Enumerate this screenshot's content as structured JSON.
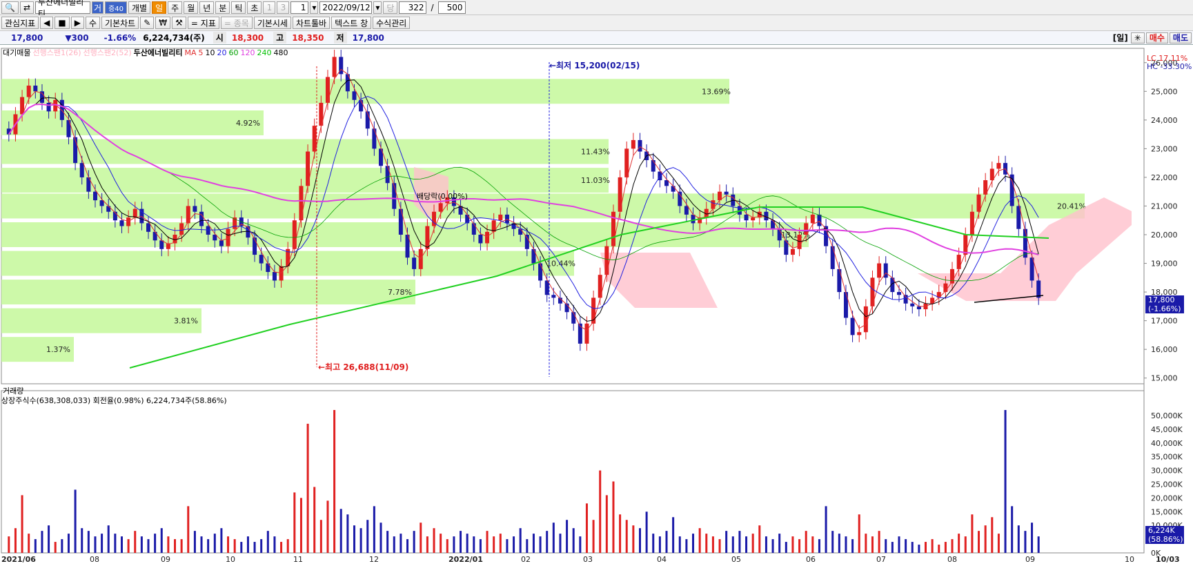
{
  "toolbar1": {
    "stock_name": "두산에너빌리티",
    "badge": "거",
    "badge2": "증40",
    "mode": "개별",
    "periods": [
      "일",
      "주",
      "월",
      "년",
      "분",
      "틱",
      "초"
    ],
    "period_nums": [
      "1",
      "3"
    ],
    "count_value": "1",
    "date_value": "2022/09/12",
    "date_prefix": "당",
    "view_count": "322",
    "slash": "/",
    "total_count": "500"
  },
  "toolbar2": {
    "indicator_label": "관심지표",
    "nav_buttons": [
      "◀",
      "■",
      "▶",
      "수"
    ],
    "basic_chart": "기본차트",
    "indicator_btn": "= 지표",
    "item_btn": "= 종목",
    "basic_quote": "기본시세",
    "chart_tools": "차트툴바",
    "text_window": "텍스트 창",
    "formula_mgmt": "수식관리"
  },
  "quote": {
    "price": "17,800",
    "change": "▼300",
    "change_pct": "-1.66%",
    "volume": "6,224,734(주)",
    "open_label": "시",
    "open": "18,300",
    "high_label": "고",
    "high": "18,350",
    "low_label": "저",
    "low": "17,800",
    "right_day": "[일]",
    "buy": "매수",
    "sell": "매도"
  },
  "legend": {
    "item1": "대기매물",
    "item2": "선행스팬1(26)",
    "item3": "선행스팬2(52)",
    "stock": "두산에너빌리티",
    "ma_label": "MA",
    "ma": [
      "5",
      "10",
      "20",
      "60",
      "120",
      "240",
      "480"
    ],
    "ma_colors": [
      "#e03030",
      "#000000",
      "#2020e0",
      "#00a000",
      "#e040e0",
      "#00c000",
      "#000000"
    ]
  },
  "right_info": {
    "lc": "LC  17.11%",
    "hc": "HC -33.30%",
    "price_tag": "17,800",
    "pct_tag": "(-1.66%)",
    "vol_tag": "6,224K",
    "vol_pct_tag": "(58.86%)"
  },
  "annotations": {
    "low": "←최저 15,200(02/15)",
    "high": "←최고 26,688(11/09)",
    "dividend": "배당락(0.00%)"
  },
  "volume_panel": {
    "title": "거래량",
    "info": "상장주식수(638,308,033) 회전율(0.98%) 6,224,734주(58.86%)"
  },
  "colors": {
    "up": "#e02020",
    "down": "#1a1aa8",
    "box": "#c8f8a0",
    "cloud": "#ffc0cc"
  },
  "chart_data": {
    "type": "candlestick",
    "price_axis": [
      "26,000",
      "25,000",
      "24,000",
      "23,000",
      "22,000",
      "21,000",
      "20,000",
      "19,000",
      "18,000",
      "17,000",
      "16,000",
      "15,000"
    ],
    "price_range": [
      14800,
      26500
    ],
    "volume_axis": [
      "50,000K",
      "45,000K",
      "40,000K",
      "35,000K",
      "30,000K",
      "25,000K",
      "20,000K",
      "15,000K",
      "10,000K",
      "5,000K",
      "0K"
    ],
    "x_labels": [
      "2021/06",
      "08",
      "09",
      "10",
      "11",
      "12",
      "2022/01",
      "02",
      "03",
      "04",
      "05",
      "06",
      "07",
      "08",
      "09",
      "10",
      "10/03"
    ],
    "supply_zones": [
      {
        "pct": "13.69%",
        "price": 25000
      },
      {
        "pct": "4.92%",
        "price": 23900
      },
      {
        "pct": "11.43%",
        "price": 22900
      },
      {
        "pct": "11.03%",
        "price": 21900
      },
      {
        "pct": "20.41%",
        "price": 21000
      },
      {
        "pct": "13.12%",
        "price": 20000
      },
      {
        "pct": "10.44%",
        "price": 19000
      },
      {
        "pct": "7.78%",
        "price": 18000
      },
      {
        "pct": "3.81%",
        "price": 17000
      },
      {
        "pct": "1.37%",
        "price": 16000
      }
    ],
    "candles_close": [
      23500,
      24200,
      24800,
      25200,
      25000,
      24600,
      24300,
      24700,
      24000,
      23400,
      22500,
      22000,
      21500,
      21200,
      21000,
      20800,
      20500,
      20300,
      20600,
      20900,
      20400,
      20100,
      19800,
      19500,
      19700,
      20000,
      20400,
      21000,
      20800,
      20300,
      20000,
      19800,
      19600,
      20200,
      20600,
      20300,
      19900,
      19300,
      19000,
      18700,
      18400,
      18900,
      19500,
      20500,
      21700,
      22900,
      23800,
      24600,
      25500,
      26200,
      25600,
      25000,
      24700,
      24300,
      23700,
      23000,
      22400,
      21800,
      20900,
      20000,
      19200,
      18800,
      19500,
      20300,
      20800,
      21100,
      21300,
      21000,
      20700,
      20400,
      20000,
      19700,
      20100,
      20500,
      20700,
      20400,
      20200,
      20000,
      19500,
      19000,
      18400,
      17900,
      17800,
      17600,
      17300,
      16900,
      16200,
      16900,
      17800,
      18600,
      19600,
      20800,
      22000,
      23000,
      23300,
      22900,
      22600,
      22200,
      21900,
      21700,
      21500,
      21000,
      20700,
      20400,
      20600,
      20900,
      21200,
      21500,
      21400,
      21000,
      20700,
      20500,
      20600,
      20800,
      20500,
      20200,
      19800,
      19300,
      19500,
      20000,
      20400,
      20700,
      20300,
      19600,
      18800,
      18000,
      17100,
      16500,
      16600,
      17500,
      18500,
      19000,
      18500,
      18000,
      17900,
      17600,
      17500,
      17400,
      17600,
      17800,
      18000,
      18300,
      18800,
      19300,
      20000,
      20800,
      21400,
      21900,
      22300,
      22500,
      22100,
      21000,
      20200,
      19200,
      18400,
      17800
    ],
    "volume": [
      6,
      9,
      21,
      7,
      5,
      8,
      10,
      4,
      5,
      7,
      23,
      9,
      8,
      6,
      7,
      10,
      7,
      6,
      5,
      8,
      6,
      5,
      7,
      9,
      6,
      5,
      5,
      17,
      8,
      6,
      5,
      7,
      9,
      6,
      5,
      4,
      6,
      4,
      5,
      8,
      6,
      4,
      5,
      22,
      20,
      47,
      24,
      12,
      19,
      52,
      16,
      14,
      10,
      9,
      12,
      17,
      11,
      8,
      6,
      7,
      5,
      8,
      11,
      6,
      9,
      7,
      5,
      6,
      8,
      7,
      6,
      5,
      8,
      6,
      7,
      5,
      6,
      9,
      5,
      7,
      6,
      8,
      11,
      7,
      12,
      9,
      6,
      18,
      12,
      30,
      21,
      26,
      14,
      12,
      10,
      9,
      15,
      7,
      6,
      8,
      13,
      6,
      5,
      7,
      9,
      7,
      6,
      5,
      8,
      6,
      8,
      6,
      7,
      10,
      6,
      5,
      7,
      4,
      6,
      5,
      8,
      6,
      5,
      17,
      8,
      7,
      6,
      5,
      14,
      7,
      6,
      8,
      5,
      4,
      6,
      5,
      4,
      3,
      4,
      5,
      3,
      4,
      5,
      7,
      6,
      14,
      8,
      10,
      13,
      7,
      52,
      17,
      10,
      8,
      11,
      6
    ]
  }
}
